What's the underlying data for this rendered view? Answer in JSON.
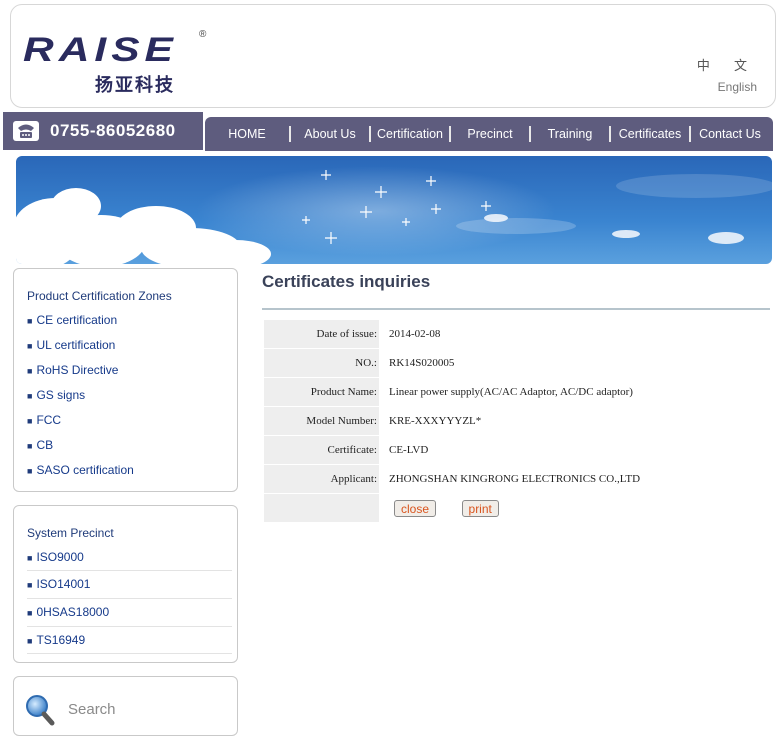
{
  "brand": {
    "logo_text": "RAISE",
    "registered": "®",
    "name_cn": "扬亚科技"
  },
  "language": {
    "chinese": "中 文",
    "english": "English"
  },
  "phone": {
    "number": "0755-86052680",
    "icon": "telephone-icon"
  },
  "nav": {
    "items": [
      "HOME",
      "About Us",
      "Certification",
      "Precinct",
      "Training",
      "Certificates",
      "Contact Us"
    ]
  },
  "sidebar": {
    "product": {
      "title": "Product Certification Zones",
      "items": [
        "CE certification",
        "UL certification",
        "RoHS Directive",
        "GS signs",
        "FCC",
        "CB",
        "SASO certification"
      ]
    },
    "system": {
      "title": "System Precinct",
      "items": [
        "ISO9000",
        "ISO14001",
        "0HSAS18000",
        "TS16949"
      ]
    },
    "search": {
      "label": "Search",
      "icon": "magnifier-icon"
    }
  },
  "main": {
    "title": "Certificates inquiries",
    "rows": [
      {
        "label": "Date of issue:",
        "value": "2014-02-08"
      },
      {
        "label": "NO.:",
        "value": "RK14S020005"
      },
      {
        "label": "Product Name:",
        "value": "Linear power supply(AC/AC Adaptor, AC/DC adaptor)"
      },
      {
        "label": "Model Number:",
        "value": "KRE-XXXYYYZL*"
      },
      {
        "label": "Certificate:",
        "value": "CE-LVD"
      },
      {
        "label": "Applicant:",
        "value": "ZHONGSHAN KINGRONG ELECTRONICS CO.,LTD"
      }
    ],
    "buttons": {
      "close": "close",
      "print": "print"
    }
  },
  "colors": {
    "nav_bg": "#5e5c7e",
    "link": "#163a8a",
    "button_text": "#d9541e",
    "title": "#3a4259"
  }
}
